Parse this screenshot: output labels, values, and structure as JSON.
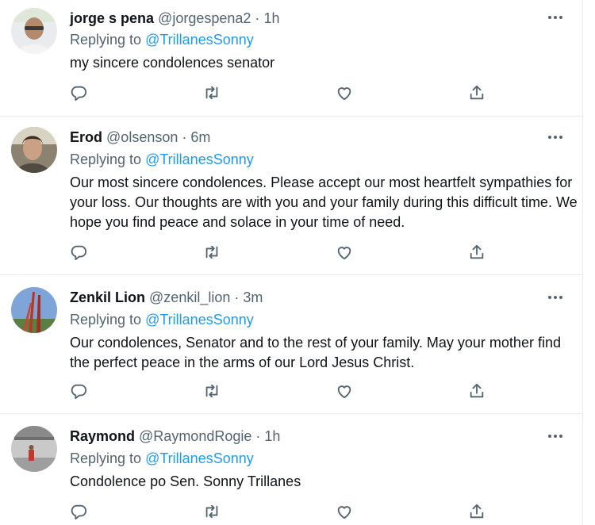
{
  "tweets": [
    {
      "name": "jorge s pena",
      "handle": "@jorgespena2",
      "separator": "·",
      "time": "1h",
      "replying_label": "Replying to",
      "replying_to": "@TrillanesSonny",
      "text": "my sincere condolences senator"
    },
    {
      "name": "Erod",
      "handle": "@olsenson",
      "separator": "·",
      "time": "6m",
      "replying_label": "Replying to",
      "replying_to": "@TrillanesSonny",
      "text": "Our most sincere condolences. Please accept our most heartfelt sympathies for your loss. Our thoughts are with you and your family during this difficult time. We hope you find peace and solace in your time of need."
    },
    {
      "name": "Zenkil Lion",
      "handle": "@zenkil_lion",
      "separator": "·",
      "time": "3m",
      "replying_label": "Replying to",
      "replying_to": "@TrillanesSonny",
      "text": "Our condolences, Senator and to the rest of your family. May your mother find the perfect peace in the arms of our Lord Jesus Christ."
    },
    {
      "name": "Raymond",
      "handle": "@RaymondRogie",
      "separator": "·",
      "time": "1h",
      "replying_label": "Replying to",
      "replying_to": "@TrillanesSonny",
      "text": "Condolence po Sen. Sonny Trillanes"
    }
  ],
  "icons": {
    "reply": "reply-icon",
    "retweet": "retweet-icon",
    "like": "heart-icon",
    "share": "share-icon",
    "more": "more-icon"
  },
  "colors": {
    "text": "#0f1419",
    "secondary": "#536471",
    "mention": "#1d9bf0",
    "divider": "#e6ecf0"
  }
}
